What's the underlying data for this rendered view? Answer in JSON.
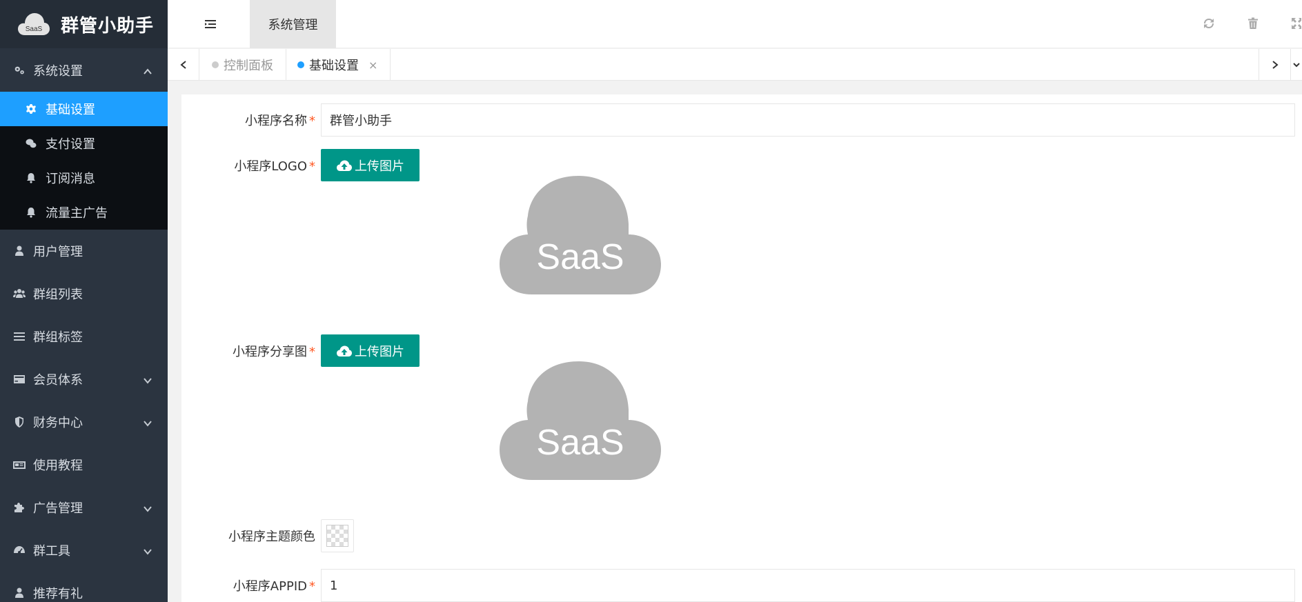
{
  "app": {
    "title": "群管小助手",
    "logo_text": "SaaS"
  },
  "sidebar": {
    "group": {
      "label": "系统设置",
      "icon": "gears-icon",
      "expanded": true
    },
    "sub_items": [
      {
        "label": "基础设置",
        "icon": "gear-icon",
        "active": true
      },
      {
        "label": "支付设置",
        "icon": "wechat-icon",
        "active": false
      },
      {
        "label": "订阅消息",
        "icon": "bell-icon",
        "active": false
      },
      {
        "label": "流量主广告",
        "icon": "bell-icon",
        "active": false
      }
    ],
    "items": [
      {
        "label": "用户管理",
        "icon": "user-icon",
        "has_children": false
      },
      {
        "label": "群组列表",
        "icon": "users-icon",
        "has_children": false
      },
      {
        "label": "群组标签",
        "icon": "list-icon",
        "has_children": false
      },
      {
        "label": "会员体系",
        "icon": "card-icon",
        "has_children": true
      },
      {
        "label": "财务中心",
        "icon": "shield-icon",
        "has_children": true
      },
      {
        "label": "使用教程",
        "icon": "newspaper-icon",
        "has_children": false
      },
      {
        "label": "广告管理",
        "icon": "puzzle-icon",
        "has_children": true
      },
      {
        "label": "群工具",
        "icon": "dashboard-icon",
        "has_children": true
      },
      {
        "label": "推荐有礼",
        "icon": "user-icon",
        "has_children": false
      }
    ]
  },
  "header": {
    "tab_label": "系统管理"
  },
  "tabs": [
    {
      "label": "控制面板",
      "active": false
    },
    {
      "label": "基础设置",
      "active": true,
      "close": "×"
    }
  ],
  "form": {
    "name": {
      "label": "小程序名称",
      "value": "群管小助手",
      "required": "*"
    },
    "logo": {
      "label": "小程序LOGO",
      "button": "上传图片",
      "required": "*",
      "preview_text": "SaaS"
    },
    "share": {
      "label": "小程序分享图",
      "button": "上传图片",
      "required": "*",
      "preview_text": "SaaS"
    },
    "theme": {
      "label": "小程序主题颜色"
    },
    "appid": {
      "label": "小程序APPID",
      "value": "1",
      "required": "*"
    }
  },
  "colors": {
    "sidebar": "#2b3440",
    "active": "#1e9fff",
    "upload": "#009688",
    "required": "#ff5722"
  }
}
